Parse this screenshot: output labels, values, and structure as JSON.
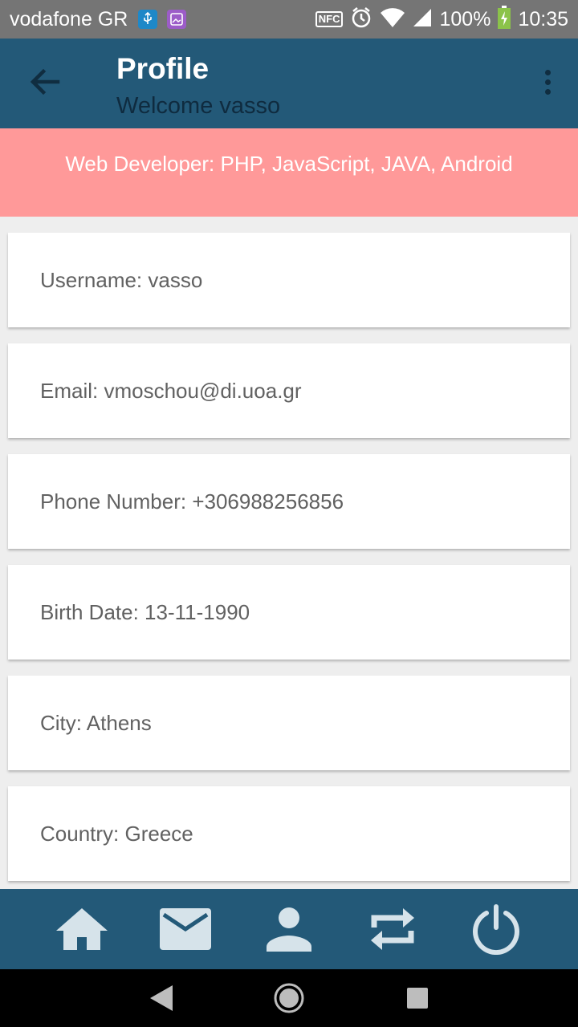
{
  "status_bar": {
    "carrier": "vodafone GR",
    "nfc": "NFC",
    "battery": "100%",
    "time": "10:35"
  },
  "toolbar": {
    "title": "Profile",
    "subtitle": "Welcome vasso",
    "back_icon": "arrow-back-icon",
    "menu_icon": "more-vert-icon"
  },
  "banner": {
    "text": "Web Developer: PHP, JavaScript, JAVA, Android"
  },
  "cards": [
    {
      "text": "Username: vasso"
    },
    {
      "text": "Email: vmoschou@di.uoa.gr"
    },
    {
      "text": "Phone Number: +306988256856"
    },
    {
      "text": "Birth Date: 13-11-1990"
    },
    {
      "text": "City: Athens"
    },
    {
      "text": "Country: Greece"
    }
  ],
  "bottom_nav": [
    "home-icon",
    "mail-icon",
    "person-icon",
    "repeat-icon",
    "power-icon"
  ],
  "colors": {
    "primary": "#235978",
    "banner": "#ff9999",
    "status_bar": "#757575",
    "background": "#eeeeee",
    "icon_light": "#d6e3ea"
  }
}
